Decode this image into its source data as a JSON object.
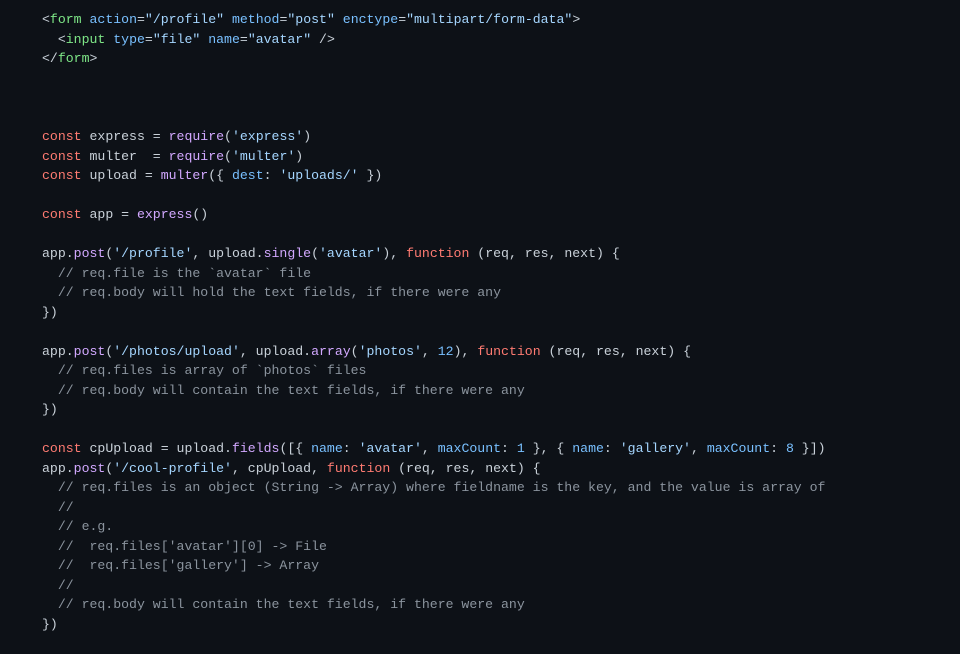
{
  "code_lines": [
    [
      [
        "p",
        "<"
      ],
      [
        "tg",
        "form"
      ],
      [
        "p",
        " "
      ],
      [
        "at",
        "action"
      ],
      [
        "p",
        "="
      ],
      [
        "st",
        "\"/profile\""
      ],
      [
        "p",
        " "
      ],
      [
        "at",
        "method"
      ],
      [
        "p",
        "="
      ],
      [
        "st",
        "\"post\""
      ],
      [
        "p",
        " "
      ],
      [
        "at",
        "enctype"
      ],
      [
        "p",
        "="
      ],
      [
        "st",
        "\"multipart/form-data\""
      ],
      [
        "p",
        ">"
      ]
    ],
    [
      [
        "p",
        "  <"
      ],
      [
        "tg",
        "input"
      ],
      [
        "p",
        " "
      ],
      [
        "at",
        "type"
      ],
      [
        "p",
        "="
      ],
      [
        "st",
        "\"file\""
      ],
      [
        "p",
        " "
      ],
      [
        "at",
        "name"
      ],
      [
        "p",
        "="
      ],
      [
        "st",
        "\"avatar\""
      ],
      [
        "p",
        " />"
      ]
    ],
    [
      [
        "p",
        "</"
      ],
      [
        "tg",
        "form"
      ],
      [
        "p",
        ">"
      ]
    ],
    [],
    [],
    [],
    [
      [
        "kw",
        "const"
      ],
      [
        "p",
        " express = "
      ],
      [
        "fn",
        "require"
      ],
      [
        "p",
        "("
      ],
      [
        "st",
        "'express'"
      ],
      [
        "p",
        ")"
      ]
    ],
    [
      [
        "kw",
        "const"
      ],
      [
        "p",
        " multer  = "
      ],
      [
        "fn",
        "require"
      ],
      [
        "p",
        "("
      ],
      [
        "st",
        "'multer'"
      ],
      [
        "p",
        ")"
      ]
    ],
    [
      [
        "kw",
        "const"
      ],
      [
        "p",
        " upload = "
      ],
      [
        "fn",
        "multer"
      ],
      [
        "p",
        "({ "
      ],
      [
        "at",
        "dest"
      ],
      [
        "p",
        ": "
      ],
      [
        "st",
        "'uploads/'"
      ],
      [
        "p",
        " })"
      ]
    ],
    [],
    [
      [
        "kw",
        "const"
      ],
      [
        "p",
        " app = "
      ],
      [
        "fn",
        "express"
      ],
      [
        "p",
        "()"
      ]
    ],
    [],
    [
      [
        "p",
        "app."
      ],
      [
        "fn",
        "post"
      ],
      [
        "p",
        "("
      ],
      [
        "st",
        "'/profile'"
      ],
      [
        "p",
        ", upload."
      ],
      [
        "fn",
        "single"
      ],
      [
        "p",
        "("
      ],
      [
        "st",
        "'avatar'"
      ],
      [
        "p",
        "), "
      ],
      [
        "kw",
        "function"
      ],
      [
        "p",
        " (req, res, next) {"
      ]
    ],
    [
      [
        "cm",
        "  // req.file is the `avatar` file"
      ]
    ],
    [
      [
        "cm",
        "  // req.body will hold the text fields, if there were any"
      ]
    ],
    [
      [
        "p",
        "})"
      ]
    ],
    [],
    [
      [
        "p",
        "app."
      ],
      [
        "fn",
        "post"
      ],
      [
        "p",
        "("
      ],
      [
        "st",
        "'/photos/upload'"
      ],
      [
        "p",
        ", upload."
      ],
      [
        "fn",
        "array"
      ],
      [
        "p",
        "("
      ],
      [
        "st",
        "'photos'"
      ],
      [
        "p",
        ", "
      ],
      [
        "nm",
        "12"
      ],
      [
        "p",
        "), "
      ],
      [
        "kw",
        "function"
      ],
      [
        "p",
        " (req, res, next) {"
      ]
    ],
    [
      [
        "cm",
        "  // req.files is array of `photos` files"
      ]
    ],
    [
      [
        "cm",
        "  // req.body will contain the text fields, if there were any"
      ]
    ],
    [
      [
        "p",
        "})"
      ]
    ],
    [],
    [
      [
        "kw",
        "const"
      ],
      [
        "p",
        " cpUpload = upload."
      ],
      [
        "fn",
        "fields"
      ],
      [
        "p",
        "([{ "
      ],
      [
        "at",
        "name"
      ],
      [
        "p",
        ": "
      ],
      [
        "st",
        "'avatar'"
      ],
      [
        "p",
        ", "
      ],
      [
        "at",
        "maxCount"
      ],
      [
        "p",
        ": "
      ],
      [
        "nm",
        "1"
      ],
      [
        "p",
        " }, { "
      ],
      [
        "at",
        "name"
      ],
      [
        "p",
        ": "
      ],
      [
        "st",
        "'gallery'"
      ],
      [
        "p",
        ", "
      ],
      [
        "at",
        "maxCount"
      ],
      [
        "p",
        ": "
      ],
      [
        "nm",
        "8"
      ],
      [
        "p",
        " }])"
      ]
    ],
    [
      [
        "p",
        "app."
      ],
      [
        "fn",
        "post"
      ],
      [
        "p",
        "("
      ],
      [
        "st",
        "'/cool-profile'"
      ],
      [
        "p",
        ", cpUpload, "
      ],
      [
        "kw",
        "function"
      ],
      [
        "p",
        " (req, res, next) {"
      ]
    ],
    [
      [
        "cm",
        "  // req.files is an object (String -> Array) where fieldname is the key, and the value is array of"
      ]
    ],
    [
      [
        "cm",
        "  //"
      ]
    ],
    [
      [
        "cm",
        "  // e.g."
      ]
    ],
    [
      [
        "cm",
        "  //  req.files['avatar'][0] -> File"
      ]
    ],
    [
      [
        "cm",
        "  //  req.files['gallery'] -> Array"
      ]
    ],
    [
      [
        "cm",
        "  //"
      ]
    ],
    [
      [
        "cm",
        "  // req.body will contain the text fields, if there were any"
      ]
    ],
    [
      [
        "p",
        "})"
      ]
    ]
  ]
}
